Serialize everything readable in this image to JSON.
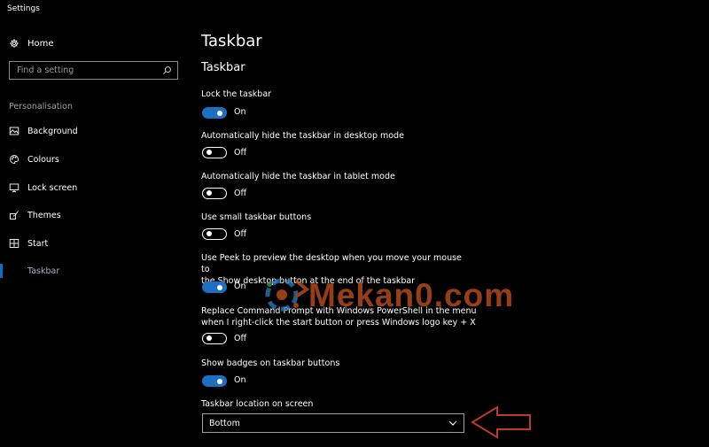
{
  "window": {
    "title": "Settings"
  },
  "sidebar": {
    "home_label": "Home",
    "search_placeholder": "Find a setting",
    "section_label": "Personalisation",
    "items": [
      {
        "label": "Background",
        "icon": "image-icon"
      },
      {
        "label": "Colours",
        "icon": "palette-icon"
      },
      {
        "label": "Lock screen",
        "icon": "monitor-icon"
      },
      {
        "label": "Themes",
        "icon": "brush-icon"
      },
      {
        "label": "Start",
        "icon": "grid-icon"
      },
      {
        "label": "Taskbar",
        "icon": "taskbar-icon",
        "active": true
      }
    ]
  },
  "main": {
    "page_title": "Taskbar",
    "section_title": "Taskbar",
    "settings": [
      {
        "label": "Lock the taskbar",
        "state": "On"
      },
      {
        "label": "Automatically hide the taskbar in desktop mode",
        "state": "Off"
      },
      {
        "label": "Automatically hide the taskbar in tablet mode",
        "state": "Off"
      },
      {
        "label": "Use small taskbar buttons",
        "state": "Off"
      },
      {
        "label_line1": "Use Peek to preview the desktop when you move your mouse to",
        "label_line2": "the Show desktop button at the end of the taskbar",
        "state": "On"
      },
      {
        "label_line1": "Replace Command Prompt with Windows PowerShell in the menu",
        "label_line2": "when I right-click the start button or press Windows logo key + X",
        "state": "Off"
      },
      {
        "label": "Show badges on taskbar buttons",
        "state": "On"
      }
    ],
    "location": {
      "label": "Taskbar location on screen",
      "value": "Bottom"
    }
  },
  "watermark": {
    "text": "Mekan0.com"
  },
  "colors": {
    "accent": "#1f6fc0",
    "arrow": "#c0392b",
    "watermark": "#c8541e"
  }
}
